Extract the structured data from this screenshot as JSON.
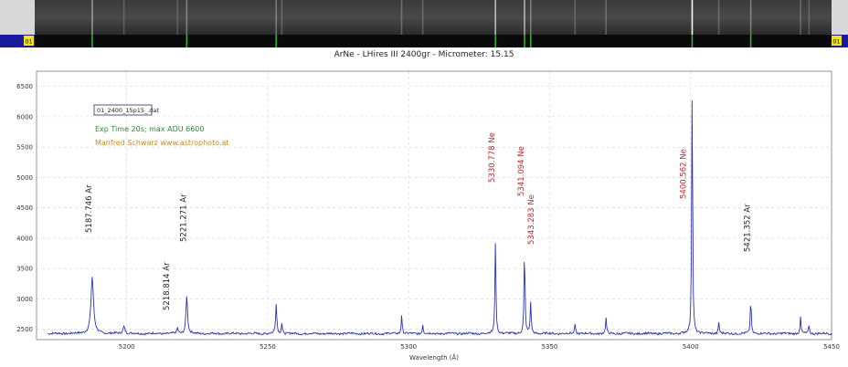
{
  "header": {
    "title": "ArNe - LHires III 2400gr - Micrometer: 15.15",
    "strip_badge_left": "01",
    "strip_badge_right": "01"
  },
  "colors": {
    "line": "#2b2fc2",
    "ne_label": "#c0282a",
    "ar_label": "#222222",
    "exp_text": "#2d8a2d",
    "author_text": "#c98a1e",
    "strip_band": "#1a1aa0",
    "strip_badge": "#f5e600"
  },
  "chart_data": {
    "type": "line",
    "title": "ArNe - LHires III 2400gr - Micrometer: 15.15",
    "xlabel": "Wavelength (Å)",
    "ylabel": "",
    "xlim": [
      5168,
      5450
    ],
    "ylim": [
      2330,
      6750
    ],
    "xticks": [
      5200,
      5250,
      5300,
      5350,
      5400,
      5450
    ],
    "yticks": [
      2500,
      3000,
      3500,
      4000,
      4500,
      5000,
      5500,
      6000,
      6500
    ],
    "grid": true,
    "baseline": 2430,
    "peaks": [
      {
        "x": 5187.746,
        "y": 3360,
        "w": 1.3
      },
      {
        "x": 5199.0,
        "y": 2550,
        "w": 1.0
      },
      {
        "x": 5221.271,
        "y": 3060,
        "w": 0.8
      },
      {
        "x": 5218.0,
        "y": 2520,
        "w": 0.6
      },
      {
        "x": 5253.0,
        "y": 2930,
        "w": 0.6
      },
      {
        "x": 5255.0,
        "y": 2600,
        "w": 0.5
      },
      {
        "x": 5297.5,
        "y": 2740,
        "w": 0.5
      },
      {
        "x": 5305.0,
        "y": 2580,
        "w": 0.5
      },
      {
        "x": 5330.778,
        "y": 3960,
        "w": 0.5
      },
      {
        "x": 5341.094,
        "y": 3840,
        "w": 0.5
      },
      {
        "x": 5343.283,
        "y": 2960,
        "w": 0.5
      },
      {
        "x": 5359.0,
        "y": 2590,
        "w": 0.5
      },
      {
        "x": 5370.0,
        "y": 2680,
        "w": 0.5
      },
      {
        "x": 5400.562,
        "y": 6730,
        "w": 0.45
      },
      {
        "x": 5410.0,
        "y": 2620,
        "w": 0.5
      },
      {
        "x": 5421.352,
        "y": 3010,
        "w": 0.5
      },
      {
        "x": 5439.0,
        "y": 2690,
        "w": 0.5
      },
      {
        "x": 5442.0,
        "y": 2570,
        "w": 0.5
      }
    ],
    "line_labels": [
      {
        "text": "5187.746 Ar",
        "x": 5187.746,
        "element": "Ar"
      },
      {
        "text": "5218.814 Ar",
        "x": 5218.814,
        "element": "Ar"
      },
      {
        "text": "5221.271 Ar",
        "x": 5221.271,
        "element": "Ar"
      },
      {
        "text": "5330.778 Ne",
        "x": 5330.778,
        "element": "Ne"
      },
      {
        "text": "5341.094 Ne",
        "x": 5341.094,
        "element": "Ne"
      },
      {
        "text": "5343.283 Ne",
        "x": 5343.283,
        "element": "Ne"
      },
      {
        "text": "5400.562 Ne",
        "x": 5400.562,
        "element": "Ne"
      },
      {
        "text": "5421.352 Ar",
        "x": 5421.352,
        "element": "Ar"
      }
    ],
    "annotations": {
      "file_box": "01_2400_15p15_.dat",
      "exp_text": "Exp Time 20s; max ADU 6600",
      "author_text": "Manfred Schwarz www.astrophoto.at"
    }
  }
}
